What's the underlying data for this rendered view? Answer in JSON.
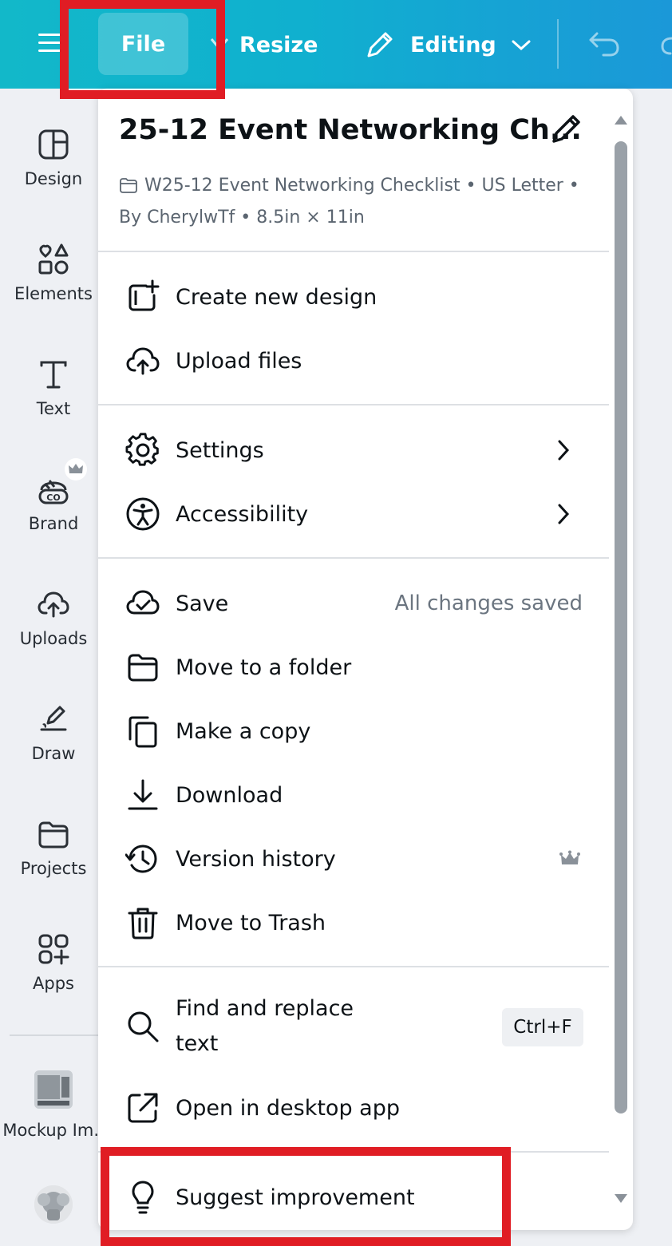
{
  "topbar": {
    "file_label": "File",
    "resize_label": "Resize",
    "editing_label": "Editing"
  },
  "sidebar": {
    "items": [
      {
        "label": "Design",
        "icon": "layout-icon"
      },
      {
        "label": "Elements",
        "icon": "shapes-icon"
      },
      {
        "label": "Text",
        "icon": "text-icon"
      },
      {
        "label": "Brand",
        "icon": "brand-icon"
      },
      {
        "label": "Uploads",
        "icon": "cloud-upload-icon"
      },
      {
        "label": "Draw",
        "icon": "draw-icon"
      },
      {
        "label": "Projects",
        "icon": "folder-icon"
      },
      {
        "label": "Apps",
        "icon": "apps-icon"
      },
      {
        "label": "Mockup Im..",
        "icon": "mockup-thumbnail"
      }
    ]
  },
  "menu": {
    "title": "25-12 Event Networking Ch...",
    "meta_line1": "W25-12 Event Networking Checklist • US Letter •",
    "meta_line2": "By CherylwTf • 8.5in × 11in",
    "create_new_design": "Create new design",
    "upload_files": "Upload files",
    "settings": "Settings",
    "accessibility": "Accessibility",
    "save": "Save",
    "save_status": "All changes saved",
    "move_to_folder": "Move to a folder",
    "make_copy": "Make a copy",
    "download": "Download",
    "version_history": "Version history",
    "move_to_trash": "Move to Trash",
    "find_replace_line1": "Find and replace",
    "find_replace_line2": "text",
    "find_replace_shortcut": "Ctrl+F",
    "open_desktop": "Open in desktop app",
    "suggest_improvement": "Suggest improvement"
  },
  "colors": {
    "topbar_start": "#12b8c9",
    "topbar_end": "#1b98d8",
    "highlight": "#e01d24",
    "premium_crown": "#8b6cff"
  }
}
